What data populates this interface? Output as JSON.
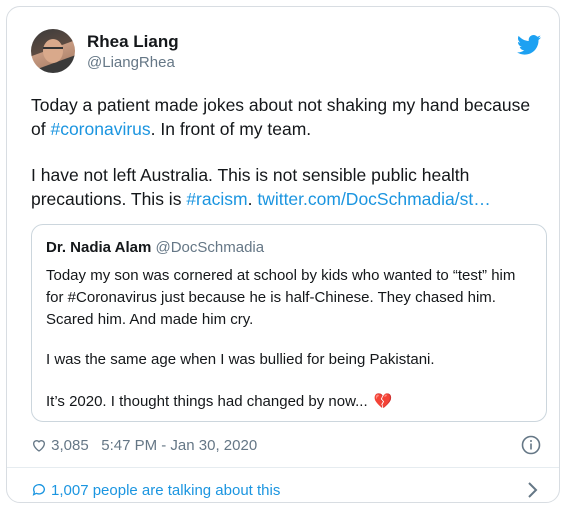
{
  "author": {
    "name": "Rhea Liang",
    "handle": "@LiangRhea"
  },
  "tweet": {
    "p1_a": "Today a patient made jokes about not shaking my hand because of ",
    "p1_tag": "#coronavirus",
    "p1_b": ". In front of my team.",
    "p2_a": "I have not left Australia. This is not sensible public health precautions. This is ",
    "p2_tag": "#racism",
    "p2_b": ". ",
    "p2_link": "twitter.com/DocSchmadia/st…"
  },
  "quoted": {
    "name": "Dr. Nadia Alam",
    "handle": "@DocSchmadia",
    "p1": "Today my son was cornered at school by kids who wanted to “test” him for #Coronavirus just because he is half-Chinese. They chased him. Scared him. And made him cry.",
    "p2": "I was the same age when I was bullied for being Pakistani.",
    "p3": "It’s 2020. I thought things had changed by now...",
    "emoji": "💔"
  },
  "meta": {
    "likes": "3,085",
    "timestamp": "5:47 PM - Jan 30, 2020"
  },
  "footer": {
    "talking": "1,007 people are talking about this"
  },
  "icons": [
    "twitter-bird-icon",
    "heart-icon",
    "info-icon",
    "chat-bubble-icon",
    "chevron-right-icon"
  ],
  "colors": {
    "accent": "#1b95e0",
    "text": "#14171a",
    "muted": "#657786"
  }
}
